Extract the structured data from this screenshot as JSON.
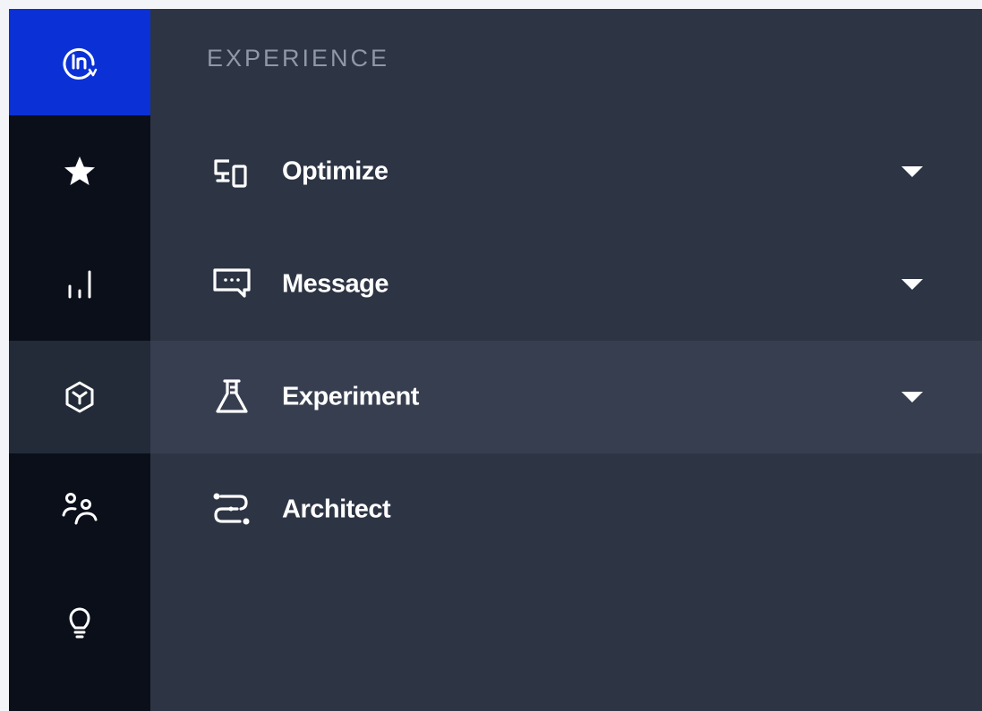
{
  "colors": {
    "background": "#f3f4f7",
    "rail_background": "#0b0f1a",
    "rail_active_background": "#232b39",
    "logo_background": "#0b31d6",
    "panel_background": "#2d3444",
    "active_row_background": "#373e50",
    "section_title": "#8f98a8",
    "text": "#ffffff"
  },
  "rail": {
    "logo_icon": "in-logo-icon",
    "items": [
      {
        "icon": "star-icon",
        "active": false
      },
      {
        "icon": "bar-chart-icon",
        "active": false
      },
      {
        "icon": "cube-icon",
        "active": true
      },
      {
        "icon": "people-icon",
        "active": false
      },
      {
        "icon": "lightbulb-icon",
        "active": false
      }
    ]
  },
  "panel": {
    "section_title": "EXPERIENCE",
    "items": [
      {
        "label": "Optimize",
        "icon": "devices-icon",
        "expandable": true,
        "active": false
      },
      {
        "label": "Message",
        "icon": "message-icon",
        "expandable": true,
        "active": false
      },
      {
        "label": "Experiment",
        "icon": "flask-icon",
        "expandable": true,
        "active": true
      },
      {
        "label": "Architect",
        "icon": "flow-icon",
        "expandable": false,
        "active": false
      }
    ]
  }
}
